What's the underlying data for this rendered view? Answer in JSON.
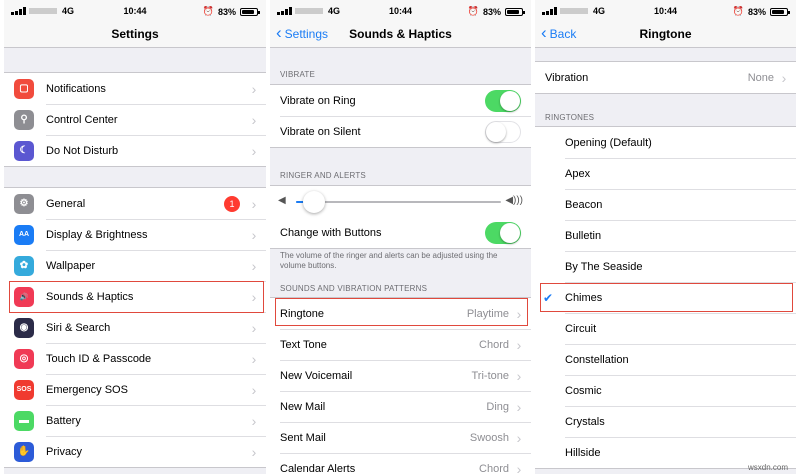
{
  "status_bars": [
    {
      "carrier": "4G",
      "time": "10:44",
      "battery": "83%"
    },
    {
      "carrier": "4G",
      "time": "10:44",
      "battery": "83%"
    },
    {
      "carrier": "4G",
      "time": "10:44",
      "battery": "83%"
    }
  ],
  "settings": {
    "title": "Settings",
    "group1": [
      {
        "label": "Notifications",
        "icon": "notifications-icon",
        "color": "#f14b3d",
        "glyph": "▢"
      },
      {
        "label": "Control Center",
        "icon": "control-center-icon",
        "color": "#8e8e93",
        "glyph": "⚲"
      },
      {
        "label": "Do Not Disturb",
        "icon": "moon-icon",
        "color": "#5b57d1",
        "glyph": "☾"
      }
    ],
    "group2": [
      {
        "label": "General",
        "icon": "gear-icon",
        "color": "#8e8e93",
        "glyph": "⚙",
        "badge": "1"
      },
      {
        "label": "Display & Brightness",
        "icon": "display-icon",
        "color": "#1a7cf5",
        "glyph": "AA"
      },
      {
        "label": "Wallpaper",
        "icon": "wallpaper-icon",
        "color": "#35aadc",
        "glyph": "✿"
      },
      {
        "label": "Sounds & Haptics",
        "icon": "speaker-icon",
        "color": "#f03a55",
        "glyph": "🔊"
      },
      {
        "label": "Siri & Search",
        "icon": "siri-icon",
        "color": "#2b2b48",
        "glyph": "◉"
      },
      {
        "label": "Touch ID & Passcode",
        "icon": "fingerprint-icon",
        "color": "#f03a55",
        "glyph": "◎"
      },
      {
        "label": "Emergency SOS",
        "icon": "sos-icon",
        "color": "#f03a30",
        "glyph": "SOS"
      },
      {
        "label": "Battery",
        "icon": "battery-icon",
        "color": "#4cd964",
        "glyph": "▬"
      },
      {
        "label": "Privacy",
        "icon": "privacy-icon",
        "color": "#2c5bd8",
        "glyph": "✋"
      }
    ]
  },
  "sounds": {
    "back_label": "Settings",
    "title": "Sounds & Haptics",
    "vibrate_header": "VIBRATE",
    "vibrate_on_ring": "Vibrate on Ring",
    "vibrate_on_silent": "Vibrate on Silent",
    "vibrate_on_ring_state": true,
    "vibrate_on_silent_state": false,
    "ringer_header": "RINGER AND ALERTS",
    "volume_level": 0.04,
    "change_with_buttons": "Change with Buttons",
    "change_with_buttons_state": true,
    "note": "The volume of the ringer and alerts can be adjusted using the volume buttons.",
    "patterns_header": "SOUNDS AND VIBRATION PATTERNS",
    "patterns": [
      {
        "label": "Ringtone",
        "value": "Playtime"
      },
      {
        "label": "Text Tone",
        "value": "Chord"
      },
      {
        "label": "New Voicemail",
        "value": "Tri-tone"
      },
      {
        "label": "New Mail",
        "value": "Ding"
      },
      {
        "label": "Sent Mail",
        "value": "Swoosh"
      },
      {
        "label": "Calendar Alerts",
        "value": "Chord"
      }
    ]
  },
  "ringtone": {
    "back_label": "Back",
    "title": "Ringtone",
    "vibration_label": "Vibration",
    "vibration_value": "None",
    "ringtones_header": "RINGTONES",
    "selected": "Chimes",
    "items": [
      "Opening (Default)",
      "Apex",
      "Beacon",
      "Bulletin",
      "By The Seaside",
      "Chimes",
      "Circuit",
      "Constellation",
      "Cosmic",
      "Crystals",
      "Hillside"
    ]
  },
  "watermark": "wsxdn.com",
  "colors": {
    "accent": "#1a7cf5",
    "toggle_on": "#4cd964",
    "highlight": "#e0493d"
  }
}
